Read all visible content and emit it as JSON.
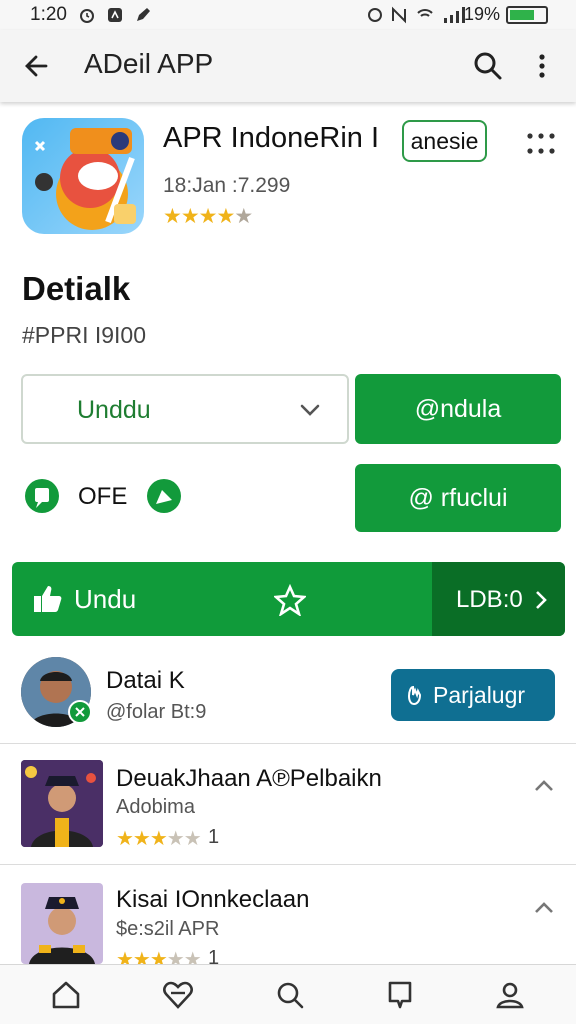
{
  "status_bar": {
    "time": "1:20",
    "battery": "19%"
  },
  "app_bar": {
    "title": "ADeil APP"
  },
  "app": {
    "name": "APR IndoneRin I",
    "language_badge": "anesie",
    "meta": "18:Jan :7.299",
    "rating": 4.5
  },
  "section": {
    "heading": "Detialk",
    "subheading": "#PPRI I9I00"
  },
  "buttons": {
    "dropdown_label": "Unddu",
    "primary_label": "@ndula",
    "secondary_label": "@ rfuclui",
    "ofe_label": "OFE"
  },
  "big_bar": {
    "label": "Undu",
    "right_label": "LDB:0"
  },
  "developer": {
    "name": "Datai K",
    "handle": "@folar Bt:9",
    "button_label": "Parjalugr"
  },
  "list": [
    {
      "title": "DeuakJhaan A℗Pelbaikn",
      "subtitle": "Adobima",
      "rating": 3.5,
      "count": "1"
    },
    {
      "title": "Kisai IOnnkeclaan",
      "subtitle": "$e:s2il APR",
      "rating": 3.5,
      "count": "1"
    }
  ],
  "colors": {
    "primary_green": "#129a3b",
    "dark_green": "#0a6e26",
    "blue_button": "#0f6f92",
    "star": "#f0b31a"
  }
}
